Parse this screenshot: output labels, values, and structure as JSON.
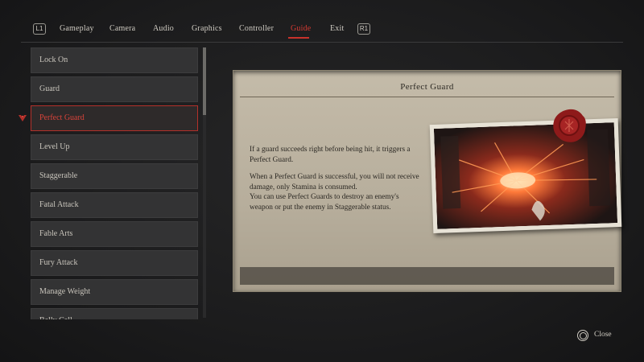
{
  "nav": {
    "left_bumper": "L1",
    "right_bumper": "R1",
    "tabs": [
      {
        "label": "Gameplay"
      },
      {
        "label": "Camera"
      },
      {
        "label": "Audio"
      },
      {
        "label": "Graphics"
      },
      {
        "label": "Controller"
      },
      {
        "label": "Guide",
        "active": true
      },
      {
        "label": "Exit"
      }
    ],
    "active_color": "#d23a32"
  },
  "guide_list": {
    "items": [
      {
        "label": "Lock On"
      },
      {
        "label": "Guard"
      },
      {
        "label": "Perfect Guard",
        "selected": true
      },
      {
        "label": "Level Up"
      },
      {
        "label": "Staggerable"
      },
      {
        "label": "Fatal Attack"
      },
      {
        "label": "Fable Arts"
      },
      {
        "label": "Fury Attack"
      },
      {
        "label": "Manage Weight"
      },
      {
        "label": "Belly Call"
      }
    ]
  },
  "detail": {
    "title": "Perfect Guard",
    "paragraphs": [
      "If a guard succeeds right before being hit, it triggers a Perfect Guard.",
      "When a Perfect Guard is successful, you will not receive damage, only Stamina is consumed.",
      "You can use Perfect Guards to destroy an enemy's weapon or put the enemy in Staggerable status."
    ],
    "image_icon": "perfect-guard-illustration",
    "seal_icon": "wax-seal-icon"
  },
  "footer": {
    "close_label": "Close",
    "close_icon": "circle-button-icon"
  }
}
